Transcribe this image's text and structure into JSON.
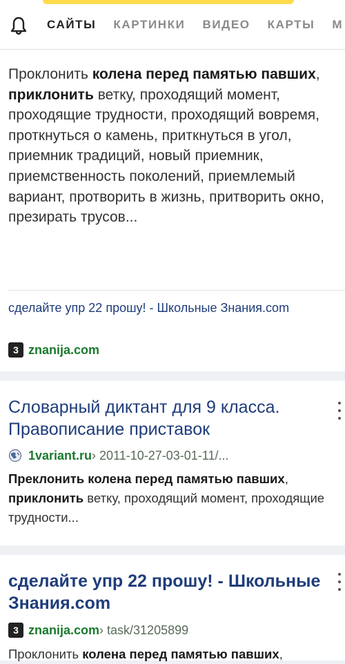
{
  "header": {
    "icon": "bell-icon",
    "tabs": [
      {
        "label": "САЙТЫ",
        "active": true
      },
      {
        "label": "КАРТИНКИ",
        "active": false
      },
      {
        "label": "ВИДЕО",
        "active": false
      },
      {
        "label": "КАРТЫ",
        "active": false
      },
      {
        "label": "М",
        "active": false
      }
    ],
    "accent_color": "#ffdb4d"
  },
  "results": [
    {
      "snippet": [
        {
          "t": "Проклонить ",
          "b": false
        },
        {
          "t": "колена перед памятью павших",
          "b": true
        },
        {
          "t": ", ",
          "b": false
        },
        {
          "t": "приклонить",
          "b": true
        },
        {
          "t": " ветку, проходящий момент, проходящие трудности, проходящий вовремя, проткнуться о камень, приткнуться в угол, приемник традиций, новый приемник, приемственность поколений, приемлемый вариант, протворить в жизнь, притворить окно, презирать трусов...",
          "b": false
        }
      ],
      "source_title": "сделайте упр 22 прошу! - Школьные Знания.com",
      "site_badge": "3",
      "domain": "znanija.com"
    },
    {
      "title": "Словарный диктант для 9 класса. Правописание приставок",
      "domain": "1variant.ru",
      "path": " › 2011-10-27-03-01-11/...",
      "snippet": [
        {
          "t": "Преклонить колена перед памятью павших",
          "b": true
        },
        {
          "t": ", ",
          "b": false
        },
        {
          "t": "приклонить",
          "b": true
        },
        {
          "t": " ветку, проходящий момент, проходящие трудности...",
          "b": false
        }
      ]
    },
    {
      "title": "сделайте упр 22 прошу! - Школьные Знания.com",
      "site_badge": "3",
      "domain": "znanija.com",
      "path": " › task/31205899",
      "snippet": [
        {
          "t": "Проклонить ",
          "b": false
        },
        {
          "t": "колена перед памятью павших",
          "b": true
        },
        {
          "t": ",",
          "b": false
        }
      ]
    }
  ]
}
